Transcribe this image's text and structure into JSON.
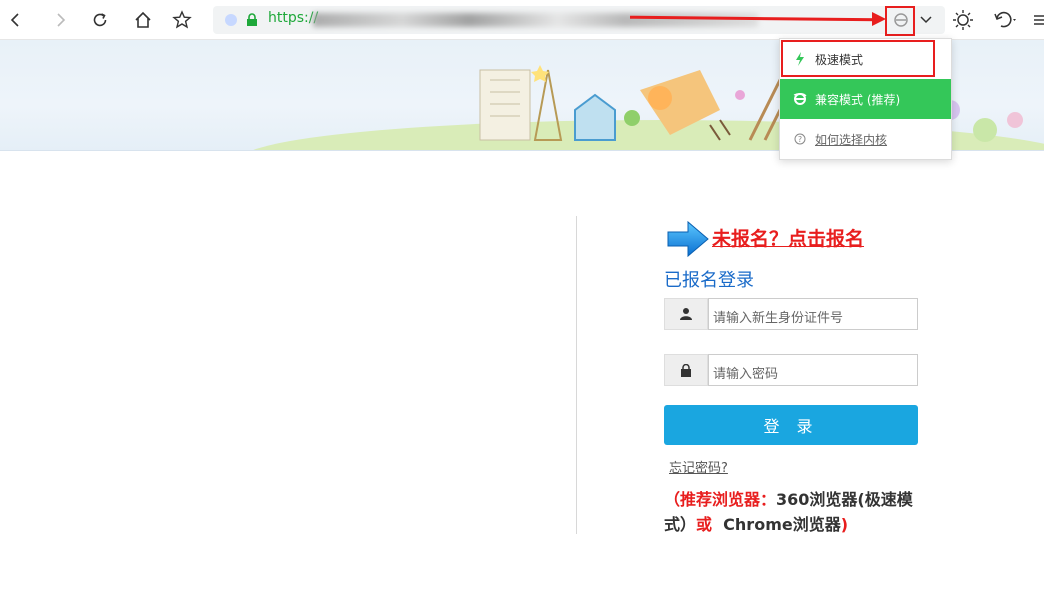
{
  "browser": {
    "url_prefix": "https://",
    "icons": [
      "back-icon",
      "forward-icon",
      "refresh-icon",
      "home-icon",
      "star-icon",
      "ie-mode-icon",
      "chevron-down-icon",
      "brightness-icon",
      "undo-icon",
      "menu-icon"
    ]
  },
  "mode_menu": {
    "items": [
      {
        "label": "极速模式",
        "icon": "lightning-icon"
      },
      {
        "label": "兼容模式 (推荐)",
        "icon": "ie-icon"
      },
      {
        "label": "如何选择内核",
        "icon": "help-icon"
      }
    ]
  },
  "page": {
    "register_link": "未报名？点击报名",
    "login_title": "已报名登录",
    "id_placeholder": "请输入新生身份证件号",
    "password_placeholder": "请输入密码",
    "login_button": "登 录",
    "forgot_password": "忘记密码?",
    "recommendation": {
      "part1": "（推荐浏览器：",
      "part2": "360浏览器(极速模式）",
      "part3": "或",
      "part4": "Chrome浏览器",
      "part5": ")"
    }
  },
  "colors": {
    "accent_green": "#34c759",
    "login_blue": "#1aa6e0",
    "title_blue": "#1a6bc9",
    "annotation_red": "#e81e1e"
  }
}
